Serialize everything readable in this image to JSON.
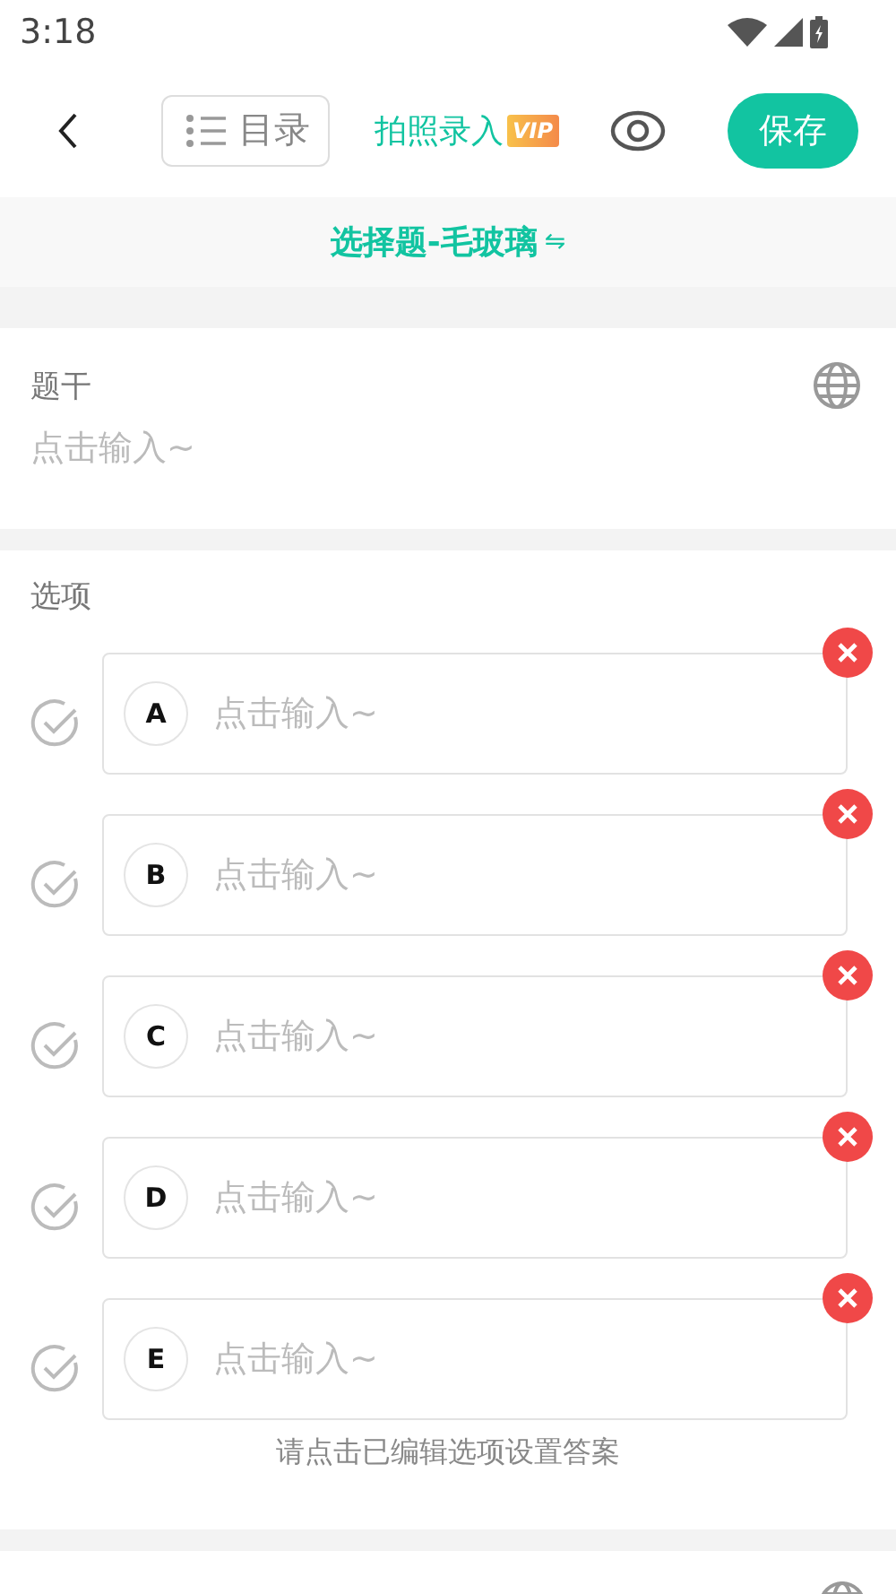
{
  "status_bar": {
    "time": "3:18"
  },
  "toolbar": {
    "catalog_label": "目录",
    "photo_label": "拍照录入",
    "vip_badge": "VIP",
    "save_label": "保存"
  },
  "question_type": {
    "title": "选择题-毛玻璃",
    "switch_icon": "⇋"
  },
  "stem": {
    "label": "题干",
    "placeholder": "点击输入~"
  },
  "options": {
    "label": "选项",
    "hint": "请点击已编辑选项设置答案",
    "items": [
      {
        "letter": "A",
        "placeholder": "点击输入~",
        "correct": false
      },
      {
        "letter": "B",
        "placeholder": "点击输入~",
        "correct": false
      },
      {
        "letter": "C",
        "placeholder": "点击输入~",
        "correct": false
      },
      {
        "letter": "D",
        "placeholder": "点击输入~",
        "correct": false
      },
      {
        "letter": "E",
        "placeholder": "点击输入~",
        "correct": false
      }
    ]
  }
}
